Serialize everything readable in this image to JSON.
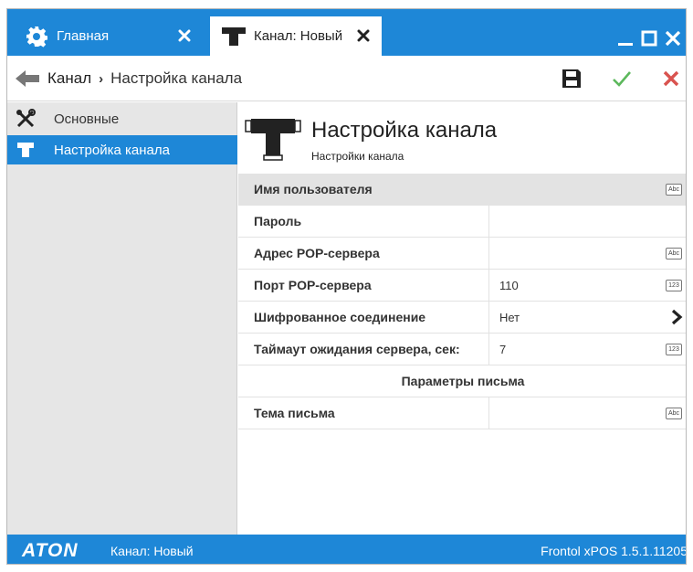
{
  "titlebar": {
    "tabs": [
      {
        "label": "Главная",
        "icon": "gear-icon"
      },
      {
        "label": "Канал: Новый",
        "icon": "tee-icon"
      }
    ],
    "window_controls": [
      "minimize-icon",
      "maximize-icon",
      "close-icon"
    ]
  },
  "toolbar": {
    "breadcrumb_root": "Канал",
    "breadcrumb_sep": "›",
    "breadcrumb_current": "Настройка канала",
    "actions": [
      "save-icon",
      "check-icon",
      "cancel-icon"
    ]
  },
  "sidebar": {
    "items": [
      {
        "label": "Основные",
        "icon": "tools-icon",
        "selected": false
      },
      {
        "label": "Настройка канала",
        "icon": "tee-icon",
        "selected": true
      }
    ]
  },
  "main": {
    "title": "Настройка канала",
    "subtitle": "Настройки канала",
    "rows": [
      {
        "name": "Имя пользователя",
        "value": "",
        "badge": "Abc"
      },
      {
        "name": "Пароль",
        "value": "",
        "badge": ""
      },
      {
        "name": "Адрес POP-сервера",
        "value": "",
        "badge": "Abc"
      },
      {
        "name": "Порт POP-сервера",
        "value": "110",
        "badge": "123"
      },
      {
        "name": "Шифрованное соединение",
        "value": "Нет",
        "badge": ""
      },
      {
        "name": "Таймаут ожидания сервера, сек:",
        "value": "7",
        "badge": "123"
      }
    ],
    "section_title": "Параметры письма",
    "section_rows": [
      {
        "name": "Тема письма",
        "value": "",
        "badge": "Abc"
      }
    ]
  },
  "statusbar": {
    "logo": "ATON",
    "document": "Канал: Новый",
    "version": "Frontol xPOS 1.5.1.11205"
  },
  "colors": {
    "accent": "#1e87d7",
    "ok": "#5cb85c",
    "cancel": "#d9534f",
    "sidebar_bg": "#e6e6e6",
    "selected_row": "#e3e3e3"
  }
}
